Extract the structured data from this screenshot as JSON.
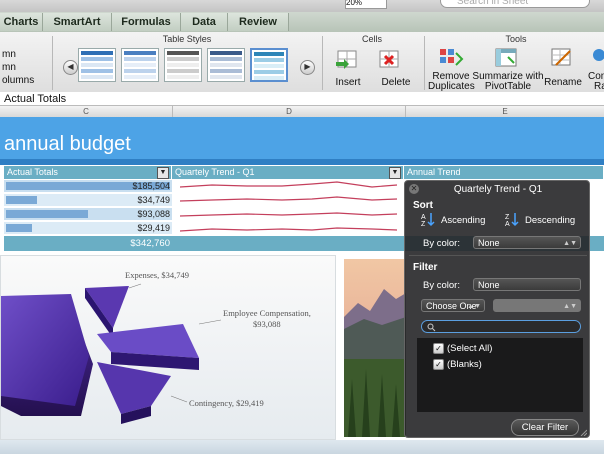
{
  "topbar": {
    "zoom": "20%",
    "search_placeholder": "Search in Sheet"
  },
  "tabs": [
    {
      "label": "Charts"
    },
    {
      "label": "SmartArt"
    },
    {
      "label": "Formulas"
    },
    {
      "label": "Data"
    },
    {
      "label": "Review"
    }
  ],
  "ribbon": {
    "left_items": [
      "mn",
      "mn",
      "olumns"
    ],
    "table_styles_label": "Table Styles",
    "cells_label": "Cells",
    "tools_label": "Tools",
    "insert_label": "Insert",
    "delete_label": "Delete",
    "remove_duplicates_label": [
      "Remove",
      "Duplicates"
    ],
    "summarize_label": [
      "Summarize with",
      "PivotTable"
    ],
    "rename_label": "Rename",
    "convert_label": [
      "Con",
      "Ra"
    ]
  },
  "formula_bar": {
    "value": "Actual Totals"
  },
  "columns": [
    "C",
    "D",
    "E"
  ],
  "sheet": {
    "title": "annual budget",
    "headers": [
      "Actual Totals",
      "Quartely Trend - Q1",
      "Annual Trend"
    ],
    "rows": [
      {
        "value": "$185,504",
        "bar_fraction": 1.0
      },
      {
        "value": "$34,749",
        "bar_fraction": 0.19
      },
      {
        "value": "$93,088",
        "bar_fraction": 0.5
      },
      {
        "value": "$29,419",
        "bar_fraction": 0.16
      }
    ],
    "total": "$342,760",
    "pie_labels": {
      "expenses": "Expenses, $34,749",
      "employee": [
        "Employee Compensation,",
        "$93,088"
      ],
      "contingency": "Contingency, $29,419"
    }
  },
  "filter_popup": {
    "title": "Quartely Trend - Q1",
    "sort_label": "Sort",
    "ascending_label": "Ascending",
    "descending_label": "Descending",
    "by_color_label": "By color:",
    "sort_color_value": "None",
    "filter_label": "Filter",
    "filter_color_value": "None",
    "choose_one": "Choose One",
    "list_items": [
      "(Select All)",
      "(Blanks)"
    ],
    "clear_filter": "Clear Filter"
  },
  "colors": {
    "accent": "#4da3e6",
    "table_header": "#6aaec4",
    "popup_bg": "#262628"
  }
}
